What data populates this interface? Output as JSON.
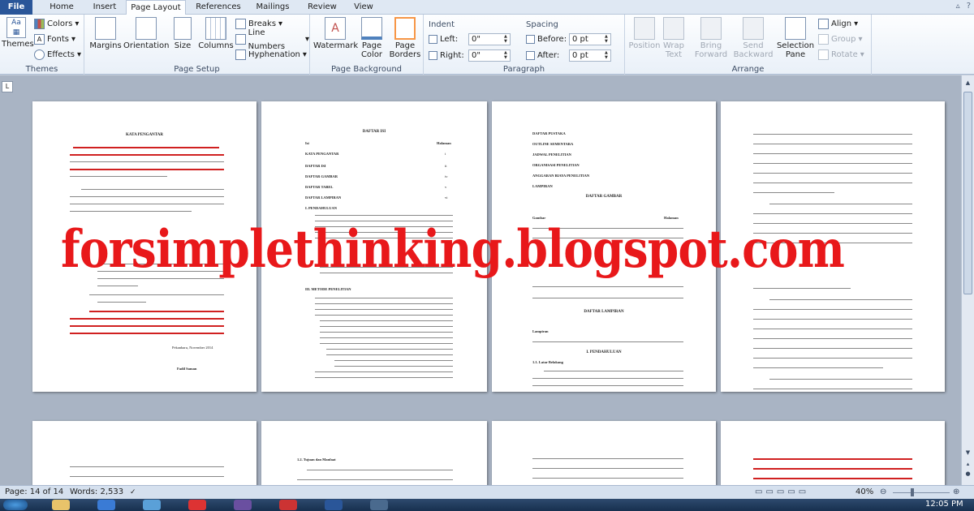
{
  "tabs": [
    "File",
    "Home",
    "Insert",
    "Page Layout",
    "References",
    "Mailings",
    "Review",
    "View"
  ],
  "ribbon": {
    "themes": {
      "button": "Themes",
      "colors": "Colors",
      "fonts": "Fonts",
      "effects": "Effects",
      "group": "Themes"
    },
    "page_setup": {
      "margins": "Margins",
      "orientation": "Orientation",
      "size": "Size",
      "columns": "Columns",
      "breaks": "Breaks",
      "line_numbers": "Line Numbers",
      "hyphenation": "Hyphenation",
      "group": "Page Setup"
    },
    "page_background": {
      "watermark": "Watermark",
      "page_color": "Page Color",
      "page_borders": "Page Borders",
      "group": "Page Background"
    },
    "paragraph": {
      "indent": "Indent",
      "left_label": "Left:",
      "left_value": "0\"",
      "right_label": "Right:",
      "right_value": "0\"",
      "spacing": "Spacing",
      "before_label": "Before:",
      "before_value": "0 pt",
      "after_label": "After:",
      "after_value": "0 pt",
      "group": "Paragraph"
    },
    "arrange": {
      "position": "Position",
      "wrap_text": "Wrap Text",
      "bring_forward": "Bring Forward",
      "send_backward": "Send Backward",
      "selection_pane": "Selection Pane",
      "align": "Align",
      "group_btn": "Group",
      "rotate": "Rotate",
      "group": "Arrange"
    }
  },
  "pages": {
    "p1": {
      "title": "KATA PENGANTAR",
      "date": "Pekanbaru, November 2014",
      "author": "Fadil Saman"
    },
    "p2": {
      "title": "DAFTAR ISI",
      "col_left": "Isi",
      "col_right": "Halaman",
      "entries": [
        {
          "label": "KATA PENGANTAR",
          "page": "i"
        },
        {
          "label": "DAFTAR ISI",
          "page": "ii"
        },
        {
          "label": "DAFTAR GAMBAR",
          "page": "iv"
        },
        {
          "label": "DAFTAR TABEL",
          "page": "v"
        },
        {
          "label": "DAFTAR LAMPIRAN",
          "page": "vi"
        },
        {
          "label": "I.   PENDAHULUAN",
          "page": ""
        },
        {
          "label": "III.   METODE PENELITIAN",
          "page": ""
        }
      ]
    },
    "p3": {
      "lines": [
        "DAFTAR PUSTAKA",
        "OUTLINE SEMENTARA",
        "JADWAL PENELITIAN",
        "ORGANISASI PENELITIAN",
        "ANGGARAN BIAYA PENELITIAN",
        "LAMPIRAN"
      ],
      "gambar_title": "DAFTAR GAMBAR",
      "gambar_col": "Gambar",
      "halaman": "Halaman",
      "lampiran_title": "DAFTAR LAMPIRAN",
      "lampiran_col": "Lampiran",
      "pendahuluan": "I.    PENDAHULUAN",
      "latar": "1.1.   Latar Belakang"
    },
    "p6": {
      "heading": "1.2.    Tujuan dan Manfaat"
    }
  },
  "watermark_text": "forsimplethinking.blogspot.com",
  "status": {
    "page": "Page: 14 of 14",
    "words": "Words: 2,533",
    "zoom": "40%"
  },
  "taskbar": {
    "time": "12:05 PM"
  },
  "colors": {
    "watermark": "#e8181a",
    "file_tab": "#2a5699"
  }
}
